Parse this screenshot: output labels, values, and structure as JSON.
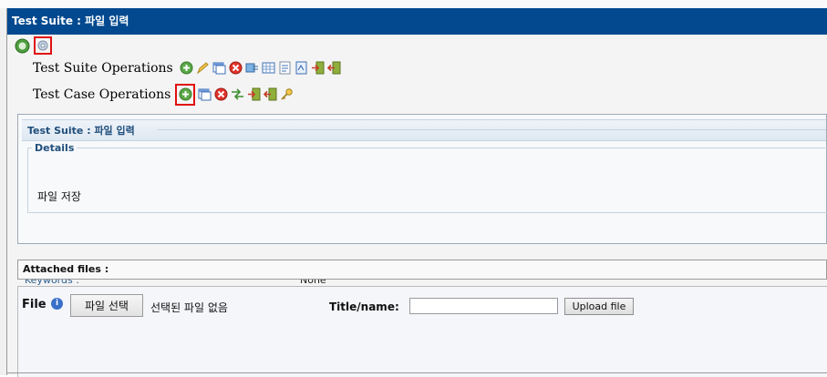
{
  "window": {
    "title": "Test Suite : 파일 입력"
  },
  "toolbar": {
    "suite_ops_label": "Test Suite Operations",
    "case_ops_label": "Test Case Operations",
    "suite_icons": [
      "create-green-icon",
      "edit-pencil-icon",
      "copy-window-icon",
      "delete-red-icon",
      "execution-icon",
      "table-icon",
      "report-icon",
      "doc-icon",
      "import-icon",
      "export-icon"
    ],
    "case_icons": [
      "create-green-icon",
      "copy-window-icon",
      "delete-red-icon",
      "move-icon",
      "import-icon",
      "export-icon",
      "edit-key-icon"
    ]
  },
  "panel": {
    "header": "Test Suite : 파일 입력",
    "details_legend": "Details",
    "details_text": "파일 저장",
    "keywords_label": "Keywords :",
    "keywords_value": "None"
  },
  "attached": {
    "label": "Attached files :"
  },
  "upload": {
    "file_label": "File",
    "info_glyph": "i",
    "choose_button": "파일 선택",
    "no_file_text": "선택된 파일 없음",
    "title_label": "Title/name:",
    "title_value": "",
    "upload_button": "Upload file"
  },
  "colors": {
    "title_bar": "#02498f",
    "highlight_box": "#e01010",
    "panel_text": "#1f4e7c"
  }
}
